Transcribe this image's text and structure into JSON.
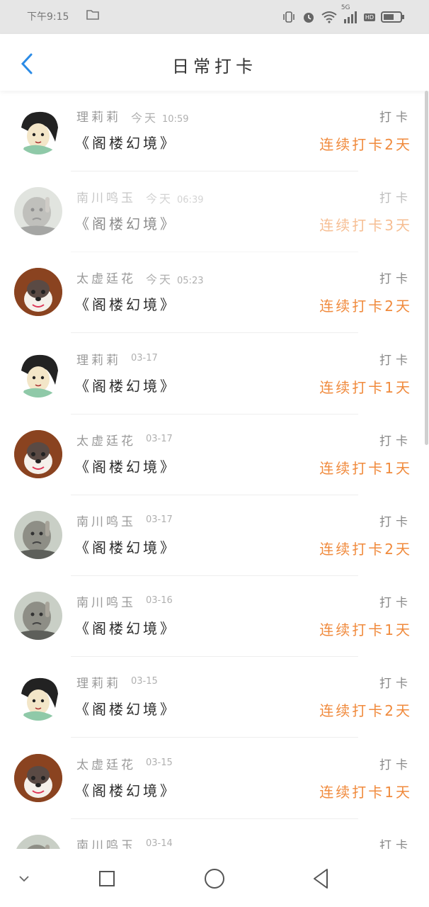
{
  "status_bar": {
    "time": "下午9:15",
    "network": "5G",
    "hd": "HD",
    "icons": [
      "folder-icon",
      "vibrate-icon",
      "alarm-icon",
      "wifi-icon",
      "signal-icon",
      "battery-icon"
    ]
  },
  "header": {
    "title": "日常打卡",
    "back_icon": "chevron-left-icon",
    "accent_color": "#2b8be6"
  },
  "checkins": [
    {
      "user": "理莉莉",
      "day": "今天",
      "time": "10:59",
      "action": "打卡",
      "book": "《阁楼幻境》",
      "streak": "连续打卡2天",
      "avatar": "anime",
      "faded": false
    },
    {
      "user": "南川鸣玉",
      "day": "今天",
      "time": "06:39",
      "action": "打卡",
      "book": "《阁楼幻境》",
      "streak": "连续打卡3天",
      "avatar": "kid",
      "faded": true
    },
    {
      "user": "太虚廷花",
      "day": "今天",
      "time": "05:23",
      "action": "打卡",
      "book": "《阁楼幻境》",
      "streak": "连续打卡2天",
      "avatar": "dog",
      "faded": false
    },
    {
      "user": "理莉莉",
      "day": "",
      "time": "03-17",
      "action": "打卡",
      "book": "《阁楼幻境》",
      "streak": "连续打卡1天",
      "avatar": "anime",
      "faded": false
    },
    {
      "user": "太虚廷花",
      "day": "",
      "time": "03-17",
      "action": "打卡",
      "book": "《阁楼幻境》",
      "streak": "连续打卡1天",
      "avatar": "dog",
      "faded": false
    },
    {
      "user": "南川鸣玉",
      "day": "",
      "time": "03-17",
      "action": "打卡",
      "book": "《阁楼幻境》",
      "streak": "连续打卡2天",
      "avatar": "kid",
      "faded": false
    },
    {
      "user": "南川鸣玉",
      "day": "",
      "time": "03-16",
      "action": "打卡",
      "book": "《阁楼幻境》",
      "streak": "连续打卡1天",
      "avatar": "kid",
      "faded": false
    },
    {
      "user": "理莉莉",
      "day": "",
      "time": "03-15",
      "action": "打卡",
      "book": "《阁楼幻境》",
      "streak": "连续打卡2天",
      "avatar": "anime",
      "faded": false
    },
    {
      "user": "太虚廷花",
      "day": "",
      "time": "03-15",
      "action": "打卡",
      "book": "《阁楼幻境》",
      "streak": "连续打卡1天",
      "avatar": "dog",
      "faded": false
    },
    {
      "user": "南川鸣玉",
      "day": "",
      "time": "03-14",
      "action": "打卡",
      "book": "",
      "streak": "",
      "avatar": "kid",
      "faded": false
    }
  ],
  "streak_color": "#f08a3c",
  "nav_bar": {
    "icons": [
      "chevron-down-icon",
      "square-icon",
      "circle-icon",
      "triangle-back-icon"
    ]
  }
}
